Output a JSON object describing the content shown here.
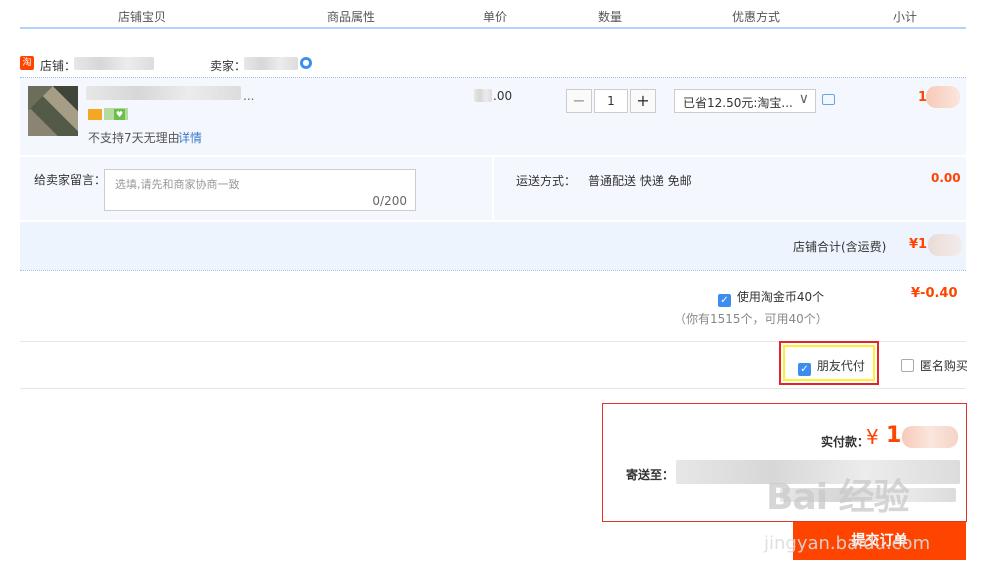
{
  "header": {
    "col_shop": "店铺宝贝",
    "col_attrs": "商品属性",
    "col_price": "单价",
    "col_qty": "数量",
    "col_discount": "优惠方式",
    "col_subtotal": "小计"
  },
  "shop": {
    "logo_text": "淘",
    "shop_label": "店铺：",
    "seller_label": "卖家："
  },
  "item": {
    "name_suffix": "...",
    "return_policy": "不支持7天无理由",
    "details_link": "详情",
    "price_suffix": ".00",
    "qty_minus": "−",
    "qty_value": "1",
    "qty_plus": "+",
    "discount_text": "已省12.50元:淘宝...",
    "subtotal_prefix": "1"
  },
  "message": {
    "label": "给卖家留言：",
    "placeholder": "选填,请先和商家协商一致",
    "counter": "0/200"
  },
  "shipping": {
    "label": "运送方式：",
    "method": "普通配送 快递 免邮",
    "fee": "0.00"
  },
  "shop_total": {
    "label": "店铺合计(含运费)",
    "value_prefix": "¥1"
  },
  "coins": {
    "label": "使用淘金币40个",
    "note": "（你有1515个，可用40个）",
    "value": "¥-0.40"
  },
  "options": {
    "friend_pay": "朋友代付",
    "anonymous": "匿名购买"
  },
  "payment": {
    "actual_label": "实付款：",
    "currency": "¥",
    "amount_prefix": "1",
    "ship_to_label": "寄送至："
  },
  "submit": {
    "label": "提交订单"
  },
  "watermark": {
    "main": "Bai 经验",
    "url": "jingyan.baidu.com"
  }
}
